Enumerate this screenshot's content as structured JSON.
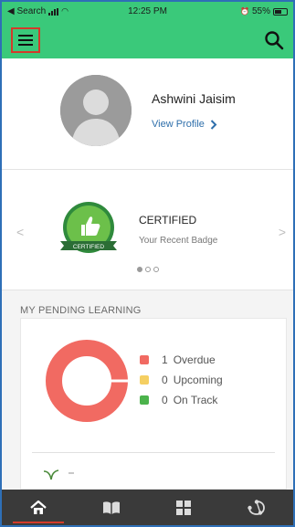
{
  "status_bar": {
    "back_label": "◀ Search",
    "time": "12:25 PM",
    "battery": "55%"
  },
  "profile": {
    "name": "Ashwini Jaisim",
    "view_profile": "View Profile"
  },
  "badge": {
    "title": "CERTIFIED",
    "subtitle": "Your Recent Badge",
    "badge_text": "CERTIFIED",
    "dots": [
      true,
      false,
      false
    ]
  },
  "pending": {
    "title": "MY PENDING LEARNING",
    "items": [
      {
        "count": "1",
        "label": "Overdue",
        "color": "#f16a62"
      },
      {
        "count": "0",
        "label": "Upcoming",
        "color": "#f5cf62"
      },
      {
        "count": "0",
        "label": "On Track",
        "color": "#4cb34c"
      }
    ]
  },
  "colors": {
    "accent": "#3ac97a",
    "highlight_border": "#d43a2a",
    "link": "#2f6fab",
    "nav_bg": "#3a3a3a"
  },
  "icons": {
    "menu": "hamburger-menu-icon",
    "search": "search-icon",
    "home": "home-icon",
    "library": "book-icon",
    "catalog": "grid-icon",
    "connect": "network-icon"
  }
}
